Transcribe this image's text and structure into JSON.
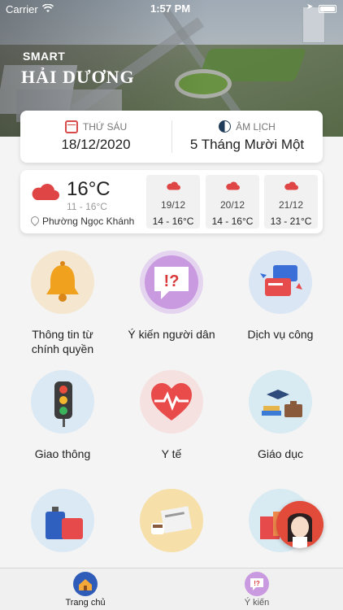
{
  "status_bar": {
    "carrier": "Carrier",
    "time": "1:57 PM"
  },
  "header": {
    "brand_small": "SMART",
    "brand_large": "HẢI DƯƠNG"
  },
  "date_card": {
    "weekday_label": "THỨ SÁU",
    "solar_date": "18/12/2020",
    "lunar_label": "ÂM LỊCH",
    "lunar_date": "5 Tháng Mười Một"
  },
  "weather": {
    "current_temp": "16°C",
    "range": "11 - 16°C",
    "location": "Phường Ngọc Khánh",
    "forecast": [
      {
        "date": "19/12",
        "range": "14 - 16°C"
      },
      {
        "date": "20/12",
        "range": "14 - 16°C"
      },
      {
        "date": "21/12",
        "range": "13 - 21°C"
      }
    ]
  },
  "menu": [
    {
      "label_line1": "Thông tin từ",
      "label_line2": "chính quyền",
      "icon": "bell-icon"
    },
    {
      "label_line1": "Ý kiến người dân",
      "label_line2": "",
      "icon": "feedback-bubble-icon"
    },
    {
      "label_line1": "Dịch vụ công",
      "label_line2": "",
      "icon": "card-exchange-icon"
    },
    {
      "label_line1": "Giao thông",
      "label_line2": "",
      "icon": "traffic-light-icon"
    },
    {
      "label_line1": "Y tế",
      "label_line2": "",
      "icon": "heart-pulse-icon"
    },
    {
      "label_line1": "Giáo dục",
      "label_line2": "",
      "icon": "graduation-cap-icon"
    },
    {
      "label_line1": "",
      "label_line2": "",
      "icon": "luggage-icon"
    },
    {
      "label_line1": "",
      "label_line2": "",
      "icon": "newspaper-coffee-icon"
    },
    {
      "label_line1": "",
      "label_line2": "",
      "icon": "shopping-bags-icon"
    }
  ],
  "tabbar": {
    "home_label": "Trang chủ",
    "feedback_label": "Ý kiến",
    "active_color": "#1a1a1a",
    "inactive_color": "#555555"
  },
  "colors": {
    "accent_red": "#e04545",
    "card_bg": "#ffffff",
    "page_bg": "#f4f4f4"
  }
}
